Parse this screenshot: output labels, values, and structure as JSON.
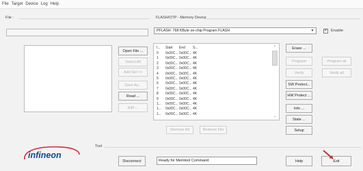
{
  "menu": [
    "File",
    "Target",
    "Device",
    "Log",
    "Help"
  ],
  "file_section": {
    "label": "File :",
    "path": "",
    "buttons": [
      {
        "label": "Open File ...",
        "enabled": true
      },
      {
        "label": "Select All",
        "enabled": false
      },
      {
        "label": "Add Sel >>",
        "enabled": false
      },
      {
        "label": "Save As...",
        "enabled": false
      },
      {
        "label": "Read ...",
        "enabled": true
      },
      {
        "label": "Edit ...",
        "enabled": false
      }
    ]
  },
  "device_section": {
    "label": "FLASH/OTP - Memory Device",
    "selected_device": "PFLASH: 768 KByte on-chip Program FLASH",
    "enable_label": "Enable",
    "enable_checked": true,
    "table_headers": [
      "I...",
      "Start",
      "End",
      "S..."
    ],
    "rows": [
      [
        "0",
        "0x00C...",
        "0x00C...",
        "4K"
      ],
      [
        "1",
        "0x00C...",
        "0x00C...",
        "4K"
      ],
      [
        "2",
        "0x00C...",
        "0x00C...",
        "4K"
      ],
      [
        "3",
        "0x00C...",
        "0x00C...",
        "4K"
      ],
      [
        "4",
        "0x00C...",
        "0x00C...",
        "4K"
      ],
      [
        "5",
        "0x00C...",
        "0x00C...",
        "4K"
      ],
      [
        "6",
        "0x00C...",
        "0x00C...",
        "4K"
      ],
      [
        "7",
        "0x00C...",
        "0x00C...",
        "4K"
      ],
      [
        "8",
        "0x00C...",
        "0x00C...",
        "4K"
      ],
      [
        "9",
        "0x00C...",
        "0x00C...",
        "4K"
      ],
      [
        "1...",
        "0x00C...",
        "0x00C...",
        "4K"
      ],
      [
        "1...",
        "0x00C...",
        "0x00C...",
        "4K"
      ],
      [
        "1...",
        "0x00C...",
        "0x00C...",
        "4K"
      ]
    ],
    "remove_all": "Remove All",
    "remove_file": "Remove File",
    "right_buttons": {
      "erase": "Erase ...",
      "program": "Program",
      "program_all": "Program all",
      "verify": "Verify",
      "verify_all": "Verify all",
      "sw_protect": "SW Protect...",
      "hw_protect": "HW Protect ...",
      "info": "Info ...",
      "state": "State ...",
      "setup": "Setup"
    }
  },
  "tool_section": {
    "label": "Tool",
    "disconnect": "Disconnect",
    "status": "Ready for Memtool Command",
    "help": "Help",
    "exit": "Exit"
  },
  "brand": {
    "name": "infineon",
    "color": "#0a4d93",
    "accent": "#d1374a"
  }
}
